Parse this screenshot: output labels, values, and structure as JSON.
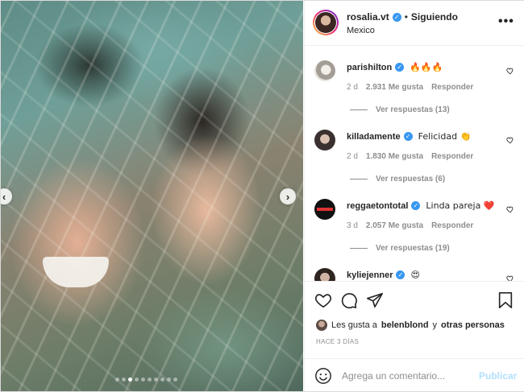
{
  "post": {
    "username": "rosalia.vt",
    "separator": "•",
    "follow_state": "Siguiendo",
    "location": "Mexico",
    "more_icon": "more-horizontal-icon",
    "carousel": {
      "slide_count": 10,
      "active_index": 2
    }
  },
  "comments": [
    {
      "username": "parishilton",
      "text": "🔥🔥🔥",
      "time": "2 d",
      "likes": "2.931 Me gusta",
      "reply": "Responder",
      "view_replies": "Ver respuestas (13)",
      "verified": true
    },
    {
      "username": "killadamente",
      "text": "Felicidad 👏",
      "time": "2 d",
      "likes": "1.830 Me gusta",
      "reply": "Responder",
      "view_replies": "Ver respuestas (6)",
      "verified": true
    },
    {
      "username": "reggaetontotal",
      "text": "Linda pareja ❤️",
      "time": "3 d",
      "likes": "2.057 Me gusta",
      "reply": "Responder",
      "view_replies": "Ver respuestas (19)",
      "verified": true
    },
    {
      "username": "kyliejenner",
      "text": "😍",
      "verified": true
    }
  ],
  "likes": {
    "prefix": "Les gusta a",
    "user": "belenblond",
    "connector": "y",
    "others": "otras personas"
  },
  "date": "HACE 3 DÍAS",
  "composer": {
    "placeholder": "Agrega un comentario...",
    "post_label": "Publicar"
  },
  "colors": {
    "verified": "#3897f0",
    "secondary_text": "#8e8e8e",
    "publish_disabled": "#b2dffc",
    "like_red": "#ed4956"
  }
}
